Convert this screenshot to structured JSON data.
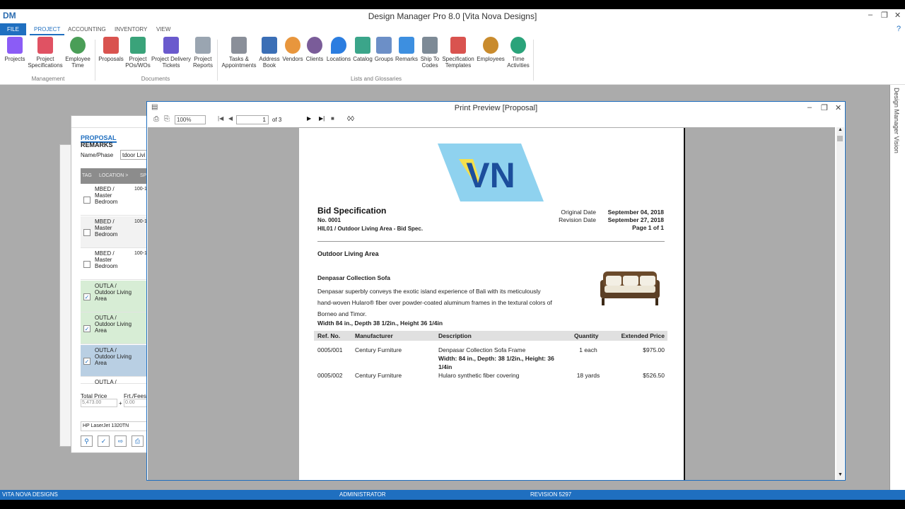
{
  "app": {
    "title": "Design Manager Pro 8.0 [Vita Nova Designs]",
    "logo": "DM"
  },
  "window_controls": {
    "minimize": "–",
    "restore": "❐",
    "close": "✕",
    "help": "?"
  },
  "tabs": [
    {
      "label": "FILE"
    },
    {
      "label": "PROJECT"
    },
    {
      "label": "ACCOUNTING"
    },
    {
      "label": "INVENTORY"
    },
    {
      "label": "VIEW"
    }
  ],
  "ribbon": {
    "buttons": [
      {
        "label": "Projects",
        "color": "#8b5cf6"
      },
      {
        "label": "Project\nSpecifications",
        "color": "#e05263"
      },
      {
        "label": "Employee\nTime",
        "color": "#4a9e57"
      },
      {
        "label": "Proposals",
        "color": "#d9534f"
      },
      {
        "label": "Project\nPOs/WOs",
        "color": "#3aa37a"
      },
      {
        "label": "Project Delivery\nTickets",
        "color": "#6a5acd"
      },
      {
        "label": "Project\nReports",
        "color": "#9aa5b1"
      },
      {
        "label": "Tasks &\nAppointments",
        "color": "#8a8f99"
      },
      {
        "label": "Address\nBook",
        "color": "#3b6fb6"
      },
      {
        "label": "Vendors",
        "color": "#e8963d"
      },
      {
        "label": "Clients",
        "color": "#7a5c99"
      },
      {
        "label": "Locations",
        "color": "#2b7de0"
      },
      {
        "label": "Catalog",
        "color": "#3ba58a"
      },
      {
        "label": "Groups",
        "color": "#6c8fc7"
      },
      {
        "label": "Remarks",
        "color": "#3d8fe0"
      },
      {
        "label": "Ship To\nCodes",
        "color": "#7d8a96"
      },
      {
        "label": "Specification\nTemplates",
        "color": "#d9534f"
      },
      {
        "label": "Employees",
        "color": "#c98b2d"
      },
      {
        "label": "Time\nActivities",
        "color": "#2aa37a"
      }
    ],
    "groups": [
      "Management",
      "Documents",
      "Lists and Glossaries"
    ]
  },
  "side_panel": {
    "label": "Design Manager Vision"
  },
  "proposal_window": {
    "tabs": [
      "PROPOSAL",
      "REMARKS"
    ],
    "name_label": "Name/Phase",
    "name_value": "tdoor Livi",
    "grid_headers": [
      "TAG",
      "LOCATION >",
      "SP CO"
    ],
    "rows": [
      {
        "location": "MBED /\nMaster\nBedroom",
        "code": "100-1",
        "checked": "",
        "bg": "#ffffff"
      },
      {
        "location": "MBED /\nMaster\nBedroom",
        "code": "100-1",
        "checked": "",
        "bg": "#f2f2f2"
      },
      {
        "location": "MBED /\nMaster\nBedroom",
        "code": "100-1",
        "checked": "",
        "bg": "#ffffff"
      },
      {
        "location": "OUTLA /\nOutdoor Living\nArea",
        "code": "",
        "checked": "✓",
        "bg": "#d7edd5"
      },
      {
        "location": "OUTLA /\nOutdoor Living\nArea",
        "code": "",
        "checked": "✓",
        "bg": "#d7edd5"
      },
      {
        "location": "OUTLA /\nOutdoor Living\nArea",
        "code": "",
        "checked": "✓",
        "bg": "#b9cfe3"
      },
      {
        "location": "OUTLA /",
        "code": "",
        "checked": "",
        "bg": "#ffffff"
      }
    ],
    "total_price_label": "Total Price",
    "total_price_value": "5,473.00",
    "frt_label": "Frt./Fees",
    "frt_value": "0.00",
    "plus": "+",
    "printer": "HP LaserJet 1320TN"
  },
  "print_preview": {
    "title": "Print Preview [Proposal]",
    "zoom": "100%",
    "page": "1",
    "of_pages": "of 3"
  },
  "document": {
    "logo_text": "VN",
    "title": "Bid Specification",
    "number": "No. 0001",
    "subtitle": "HIL01 / Outdoor Living Area - Bid Spec.",
    "original_date_label": "Original Date",
    "original_date": "September 04, 2018",
    "revision_date_label": "Revision Date",
    "revision_date": "September 27, 2018",
    "page_label": "Page 1 of 1",
    "area": "Outdoor Living Area",
    "item_name": "Denpasar Collection Sofa",
    "desc1": "Denpasar superbly conveys the exotic island experience of Bali with its meticulously",
    "desc2": "hand-woven Hularo® fiber over powder-coated aluminum frames in the textural colors of",
    "desc3": "Borneo and Timor.",
    "dims": "Width 84 in., Depth 38 1/2in., Height 36 1/4in",
    "table_headers": [
      "Ref. No.",
      "Manufacturer",
      "Description",
      "Quantity",
      "Extended Price"
    ],
    "rows": [
      {
        "ref": "0005/001",
        "mfr": "Century Furniture",
        "desc": "Denpasar Collection Sofa Frame",
        "desc2": "Width: 84 in., Depth: 38 1/2in., Height: 36",
        "desc3": "1/4in",
        "qty": "1 each",
        "price": "$975.00"
      },
      {
        "ref": "0005/002",
        "mfr": "Century Furniture",
        "desc": "Hularo synthetic fiber covering",
        "desc2": "",
        "desc3": "",
        "qty": "18 yards",
        "price": "$526.50"
      }
    ]
  },
  "status": {
    "company": "VITA NOVA DESIGNS",
    "user": "ADMINISTRATOR",
    "revision": "REVISION 5297"
  }
}
